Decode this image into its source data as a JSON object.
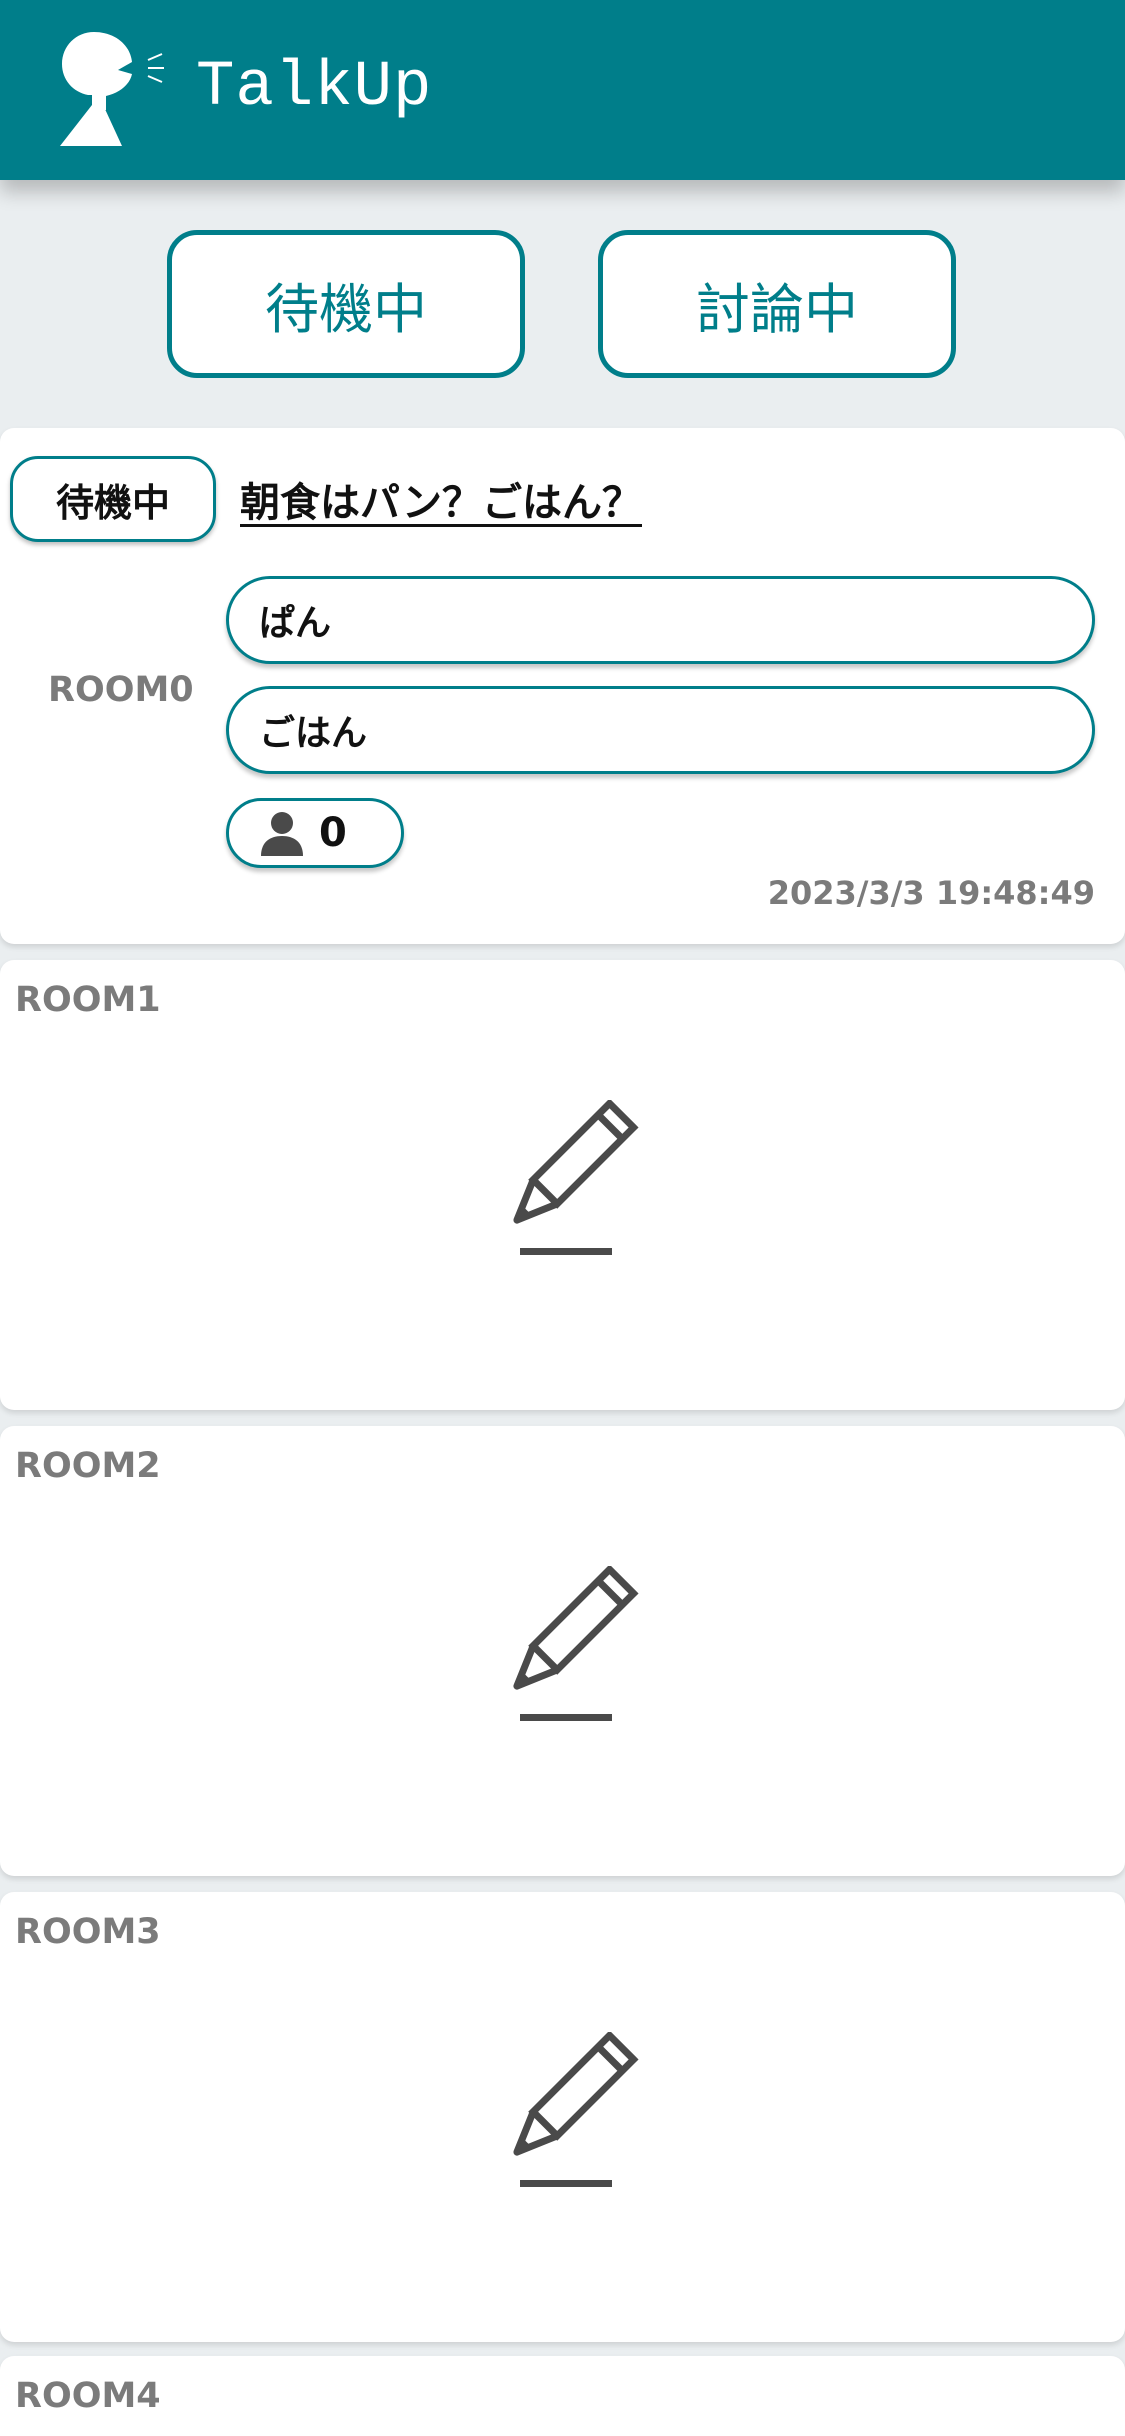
{
  "app": {
    "title": "TalkUp"
  },
  "filters": {
    "waiting_label": "待機中",
    "discussing_label": "討論中"
  },
  "rooms": [
    {
      "label": "ROOM0",
      "status": "待機中",
      "topic": "朝食はパン？ごはん？",
      "choices": [
        "ぱん",
        "ごはん"
      ],
      "participants": "0",
      "timestamp": "2023/3/3 19:48:49"
    },
    {
      "label": "ROOM1",
      "icon": "pencil-icon"
    },
    {
      "label": "ROOM2",
      "icon": "pencil-icon"
    },
    {
      "label": "ROOM3",
      "icon": "pencil-icon"
    },
    {
      "label": "ROOM4"
    }
  ],
  "colors": {
    "accent": "#007e8a",
    "background": "#eaeef0",
    "label_gray": "#7b7b7b",
    "icon_gray": "#4a4a4a"
  }
}
